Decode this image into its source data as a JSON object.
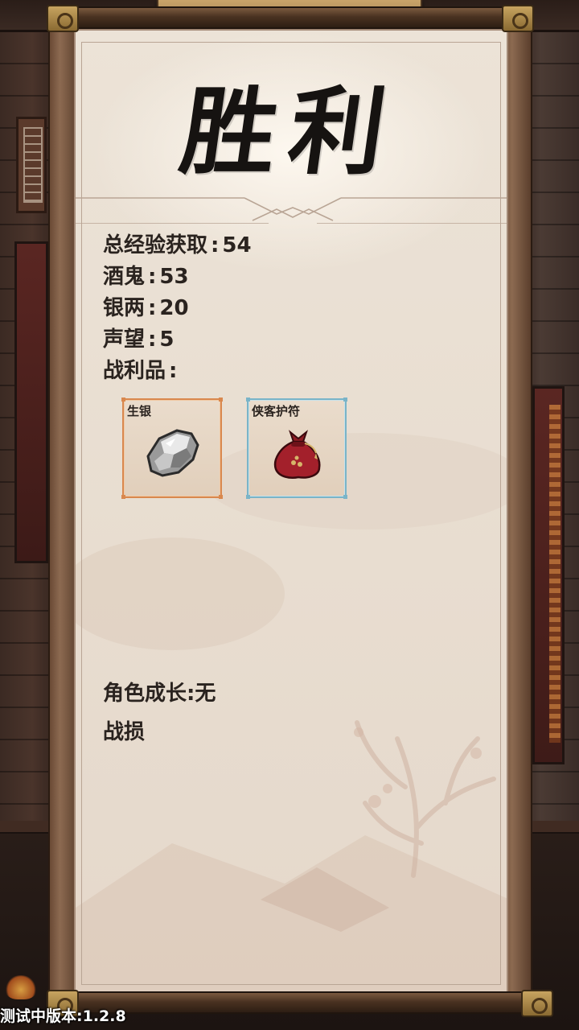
{
  "title": "胜利",
  "rewards": [
    {
      "label": "总经验获取",
      "value": "54"
    },
    {
      "label": "酒鬼",
      "value": "53"
    },
    {
      "label": "银两",
      "value": "20"
    },
    {
      "label": "声望",
      "value": "5"
    }
  ],
  "loot": {
    "label": "战利品",
    "items": [
      {
        "name": "生银",
        "icon": "silver-ore-icon",
        "rarity_color": "#d9884e"
      },
      {
        "name": "侠客护符",
        "icon": "red-pouch-amulet-icon",
        "rarity_color": "#7ab4c8"
      }
    ]
  },
  "growth": {
    "label": "角色成长",
    "value": "无"
  },
  "casualties": {
    "label": "战损"
  },
  "version": "测试中版本:1.2.8",
  "colors": {
    "paper": "#ece3d7",
    "frame": "#6a4a35",
    "text": "#2a231f"
  }
}
